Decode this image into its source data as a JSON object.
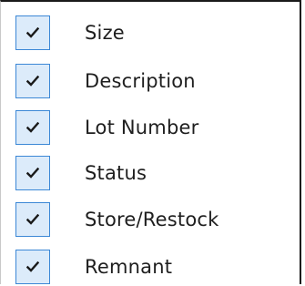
{
  "menu": {
    "items": [
      {
        "label": "Size",
        "checked": true,
        "icon": "checkmark-icon"
      },
      {
        "label": "Description",
        "checked": true,
        "icon": "checkmark-icon"
      },
      {
        "label": "Lot Number",
        "checked": true,
        "icon": "checkmark-icon"
      },
      {
        "label": "Status",
        "checked": true,
        "icon": "checkmark-icon"
      },
      {
        "label": "Store/Restock",
        "checked": true,
        "icon": "checkmark-icon"
      },
      {
        "label": "Remnant",
        "checked": true,
        "icon": "checkmark-icon"
      }
    ],
    "colors": {
      "check_border": "#3c88d6",
      "check_fill": "#dcebfa",
      "text": "#1e1e1e"
    }
  }
}
